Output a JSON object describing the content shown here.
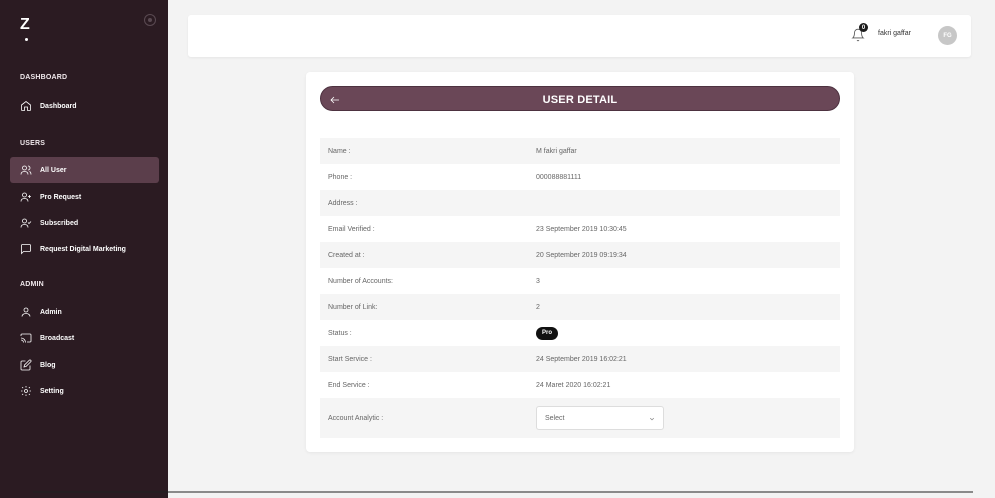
{
  "sidebar": {
    "logo": "Z",
    "sections": [
      {
        "title": "DASHBOARD",
        "items": [
          {
            "label": "Dashboard",
            "icon": "home-icon",
            "active": false
          }
        ]
      },
      {
        "title": "USERS",
        "items": [
          {
            "label": "All User",
            "icon": "users-icon",
            "active": true
          },
          {
            "label": "Pro Request",
            "icon": "user-plus-icon",
            "active": false
          },
          {
            "label": "Subscribed",
            "icon": "user-check-icon",
            "active": false
          },
          {
            "label": "Request Digital Marketing",
            "icon": "message-square-icon",
            "active": false
          }
        ]
      },
      {
        "title": "ADMIN",
        "items": [
          {
            "label": "Admin",
            "icon": "user-icon",
            "active": false
          },
          {
            "label": "Broadcast",
            "icon": "cast-icon",
            "active": false
          },
          {
            "label": "Blog",
            "icon": "edit-icon",
            "active": false
          },
          {
            "label": "Setting",
            "icon": "gear-icon",
            "active": false
          }
        ]
      }
    ]
  },
  "header": {
    "notification_count": "0",
    "user_name": "fakri gaffar",
    "avatar_initials": "FG"
  },
  "card": {
    "title": "USER DETAIL",
    "rows": [
      {
        "label": "Name :",
        "value": "M fakri gaffar"
      },
      {
        "label": "Phone :",
        "value": "000088881111"
      },
      {
        "label": "Address :",
        "value": ""
      },
      {
        "label": "Email Verified :",
        "value": "23 September 2019 10:30:45"
      },
      {
        "label": "Created at :",
        "value": "20 September 2019 09:19:34"
      },
      {
        "label": "Number of Accounts:",
        "value": "3"
      },
      {
        "label": "Number of Link:",
        "value": "2"
      },
      {
        "label": "Status :",
        "value": "Pro"
      },
      {
        "label": "Start Service :",
        "value": "24 September 2019 16:02:21"
      },
      {
        "label": "End Service :",
        "value": "24 Maret 2020 16:02:21"
      },
      {
        "label": "Account Analytic :",
        "value": "Select"
      }
    ]
  },
  "colors": {
    "sidebar_bg": "#2b1b22",
    "sidebar_active": "#5b3e4b",
    "card_header": "#6a4757",
    "status_pill": "#111111"
  }
}
